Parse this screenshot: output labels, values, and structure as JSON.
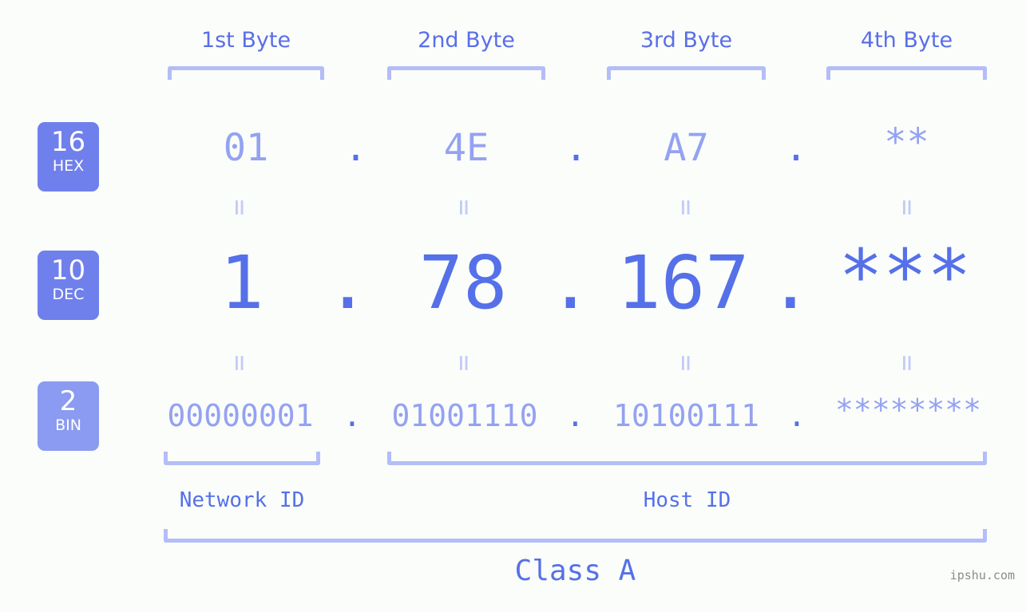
{
  "background_color": "#fbfdfa",
  "accent_color": "#5570e8",
  "accent_light_color": "#94a2f2",
  "bracket_color": "#b3bdf7",
  "badge_color": "#6f80ec",
  "byte_headers": [
    {
      "label": "1st Byte"
    },
    {
      "label": "2nd Byte"
    },
    {
      "label": "3rd Byte"
    },
    {
      "label": "4th Byte"
    }
  ],
  "bases": [
    {
      "number": "16",
      "name": "HEX"
    },
    {
      "number": "10",
      "name": "DEC"
    },
    {
      "number": "2",
      "name": "BIN"
    }
  ],
  "rows": {
    "hex": {
      "values": [
        "01",
        "4E",
        "A7",
        "**"
      ],
      "separator": "."
    },
    "dec": {
      "values": [
        "1",
        "78",
        "167",
        "***"
      ],
      "separator": "."
    },
    "bin": {
      "values": [
        "00000001",
        "01001110",
        "10100111",
        "********"
      ],
      "separator": "."
    }
  },
  "equals_sign": "=",
  "segments": [
    {
      "label": "Network ID"
    },
    {
      "label": "Host ID"
    }
  ],
  "class_label": "Class A",
  "watermark": "ipshu.com"
}
